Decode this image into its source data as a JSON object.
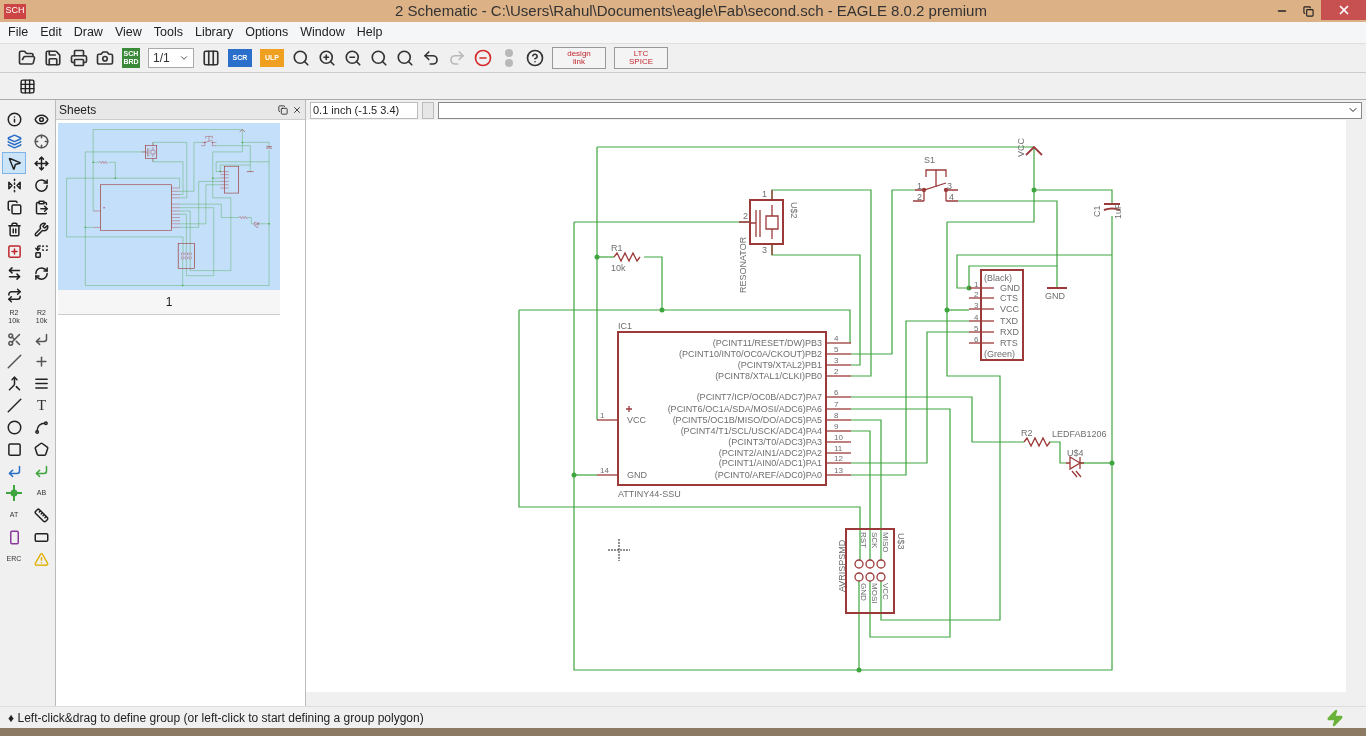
{
  "window": {
    "app_icon_label": "SCH",
    "title": "2 Schematic - C:\\Users\\Rahul\\Documents\\eagle\\Fab\\second.sch - EAGLE 8.0.2 premium"
  },
  "menu": [
    "File",
    "Edit",
    "Draw",
    "View",
    "Tools",
    "Library",
    "Options",
    "Window",
    "Help"
  ],
  "toolbar": [
    {
      "kind": "open",
      "disabled": false
    },
    {
      "kind": "save",
      "disabled": false
    },
    {
      "kind": "print",
      "disabled": false
    },
    {
      "kind": "cam",
      "disabled": false
    },
    {
      "kind": "switch",
      "labels": [
        "SCH",
        "BRD"
      ],
      "disabled": false
    },
    {
      "kind": "sheet",
      "labels": [
        "1/1"
      ],
      "disabled": false
    },
    {
      "kind": "library",
      "disabled": false
    },
    {
      "kind": "script",
      "labels": [
        "SCR"
      ],
      "disabled": false
    },
    {
      "kind": "ulp",
      "labels": [
        "ULP"
      ],
      "disabled": false
    },
    {
      "kind": "zoomfit",
      "disabled": false
    },
    {
      "kind": "zoomin",
      "disabled": false
    },
    {
      "kind": "zoomout",
      "disabled": false
    },
    {
      "kind": "zoomselect",
      "disabled": false
    },
    {
      "kind": "zoomcustom",
      "disabled": false
    },
    {
      "kind": "undo",
      "disabled": false
    },
    {
      "kind": "redo",
      "disabled": true
    },
    {
      "kind": "stop",
      "disabled": false
    },
    {
      "kind": "go",
      "disabled": true
    },
    {
      "kind": "help",
      "disabled": false
    },
    {
      "kind": "designlink",
      "labels": [
        "design",
        "link"
      ],
      "disabled": false
    },
    {
      "kind": "spice",
      "labels": [
        "LTC",
        "SPICE"
      ],
      "disabled": false
    }
  ],
  "tools": [
    {
      "kind": "info",
      "selected": false
    },
    {
      "kind": "show",
      "selected": false
    },
    {
      "kind": "layers",
      "selected": false
    },
    {
      "kind": "mark",
      "selected": false
    },
    {
      "kind": "group",
      "selected": true
    },
    {
      "kind": "move",
      "selected": false
    },
    {
      "kind": "mirror",
      "selected": false
    },
    {
      "kind": "rotate",
      "selected": false
    },
    {
      "kind": "copy",
      "selected": false
    },
    {
      "kind": "paste",
      "selected": false
    },
    {
      "kind": "delete",
      "selected": false
    },
    {
      "kind": "change",
      "selected": false
    },
    {
      "kind": "add",
      "selected": false
    },
    {
      "kind": "replace",
      "selected": false
    },
    {
      "kind": "pinswap",
      "selected": false
    },
    {
      "kind": "gateswap",
      "selected": false
    },
    {
      "kind": "invoke",
      "selected": false
    },
    {
      "kind": "name",
      "labels": [
        "R2",
        "10k"
      ],
      "selected": false
    },
    {
      "kind": "value",
      "labels": [
        "R2",
        "10k"
      ],
      "selected": false
    },
    {
      "kind": "smash",
      "selected": false
    },
    {
      "kind": "miter",
      "selected": false
    },
    {
      "kind": "split",
      "selected": false
    },
    {
      "kind": "optimize",
      "selected": false
    },
    {
      "kind": "connect",
      "selected": false
    },
    {
      "kind": "align",
      "selected": false
    },
    {
      "kind": "line",
      "selected": false
    },
    {
      "kind": "text",
      "labels": [
        "T"
      ],
      "selected": false
    },
    {
      "kind": "circle",
      "selected": false
    },
    {
      "kind": "arc",
      "selected": false
    },
    {
      "kind": "rect",
      "selected": false
    },
    {
      "kind": "polygon",
      "selected": false
    },
    {
      "kind": "bus",
      "selected": false
    },
    {
      "kind": "net",
      "selected": false
    },
    {
      "kind": "junction",
      "selected": false
    },
    {
      "kind": "label",
      "labels": [
        "AB"
      ],
      "selected": false
    },
    {
      "kind": "attribute",
      "labels": [
        "AT"
      ],
      "selected": false
    },
    {
      "kind": "dimension",
      "selected": false
    },
    {
      "kind": "frame",
      "selected": false
    },
    {
      "kind": "module",
      "selected": false
    },
    {
      "kind": "erc",
      "labels": [
        "ERC"
      ],
      "selected": false
    },
    {
      "kind": "errors",
      "selected": false
    }
  ],
  "sheets_panel": {
    "title": "Sheets",
    "sheets": [
      {
        "label": "1",
        "selected": true
      }
    ]
  },
  "coordinate_display": "0.1 inch (-1.5 3.4)",
  "schematic": {
    "parts": [
      {
        "kind": "resistor",
        "name": "R1",
        "value": "10k"
      },
      {
        "kind": "resonator",
        "name": "U$2",
        "value": "RESONATOR",
        "pins": [
          "1",
          "2",
          "3"
        ]
      },
      {
        "kind": "switch",
        "name": "S1",
        "pins": [
          "1",
          "2",
          "3",
          "4"
        ]
      },
      {
        "kind": "supply",
        "name": "VCC"
      },
      {
        "kind": "capacitor",
        "name": "C1",
        "value": "1uF"
      },
      {
        "kind": "ground",
        "name": "GND"
      },
      {
        "kind": "header",
        "name": "(Black)",
        "value": "(Green)",
        "pins": [
          {
            "number": "1",
            "label": "GND"
          },
          {
            "number": "2",
            "label": "CTS"
          },
          {
            "number": "3",
            "label": "VCC"
          },
          {
            "number": "4",
            "label": "TXD"
          },
          {
            "number": "5",
            "label": "RXD"
          },
          {
            "number": "6",
            "label": "RTS"
          }
        ]
      },
      {
        "kind": "mcu",
        "name": "IC1",
        "value": "ATTINY44-SSU",
        "left_pins": [
          {
            "number": "1",
            "label": "VCC"
          },
          {
            "number": "14",
            "label": "GND"
          }
        ],
        "right_pins": [
          {
            "number": "4",
            "label": "(PCINT11/RESET/DW)PB3"
          },
          {
            "number": "5",
            "label": "(PCINT10/INT0/OC0A/CKOUT)PB2"
          },
          {
            "number": "3",
            "label": "(PCINT9/XTAL2)PB1"
          },
          {
            "number": "2",
            "label": "(PCINT8/XTAL1/CLKI)PB0"
          },
          {
            "number": "6",
            "label": "(PCINT7/ICP/OC0B/ADC7)PA7"
          },
          {
            "number": "7",
            "label": "(PCINT6/OC1A/SDA/MOSI/ADC6)PA6"
          },
          {
            "number": "8",
            "label": "(PCINT5/OC1B/MISO/DO/ADC5)PA5"
          },
          {
            "number": "9",
            "label": "(PCINT4/T1/SCL/USCK/ADC4)PA4"
          },
          {
            "number": "10",
            "label": "(PCINT3/T0/ADC3)PA3"
          },
          {
            "number": "11",
            "label": "(PCINT2/AIN1/ADC2)PA2"
          },
          {
            "number": "12",
            "label": "(PCINT1/AIN0/ADC1)PA1"
          },
          {
            "number": "13",
            "label": "(PCINT0/AREF/ADC0)PA0"
          }
        ]
      },
      {
        "kind": "resistor",
        "name": "R2"
      },
      {
        "kind": "led",
        "name": "U$4",
        "value": "LEDFAB1206"
      },
      {
        "kind": "isp",
        "name": "U$3",
        "value": "AVRISPSMD",
        "pins": [
          "RST",
          "SCK",
          "MISO",
          "GND",
          "MOSI",
          "VCC"
        ]
      }
    ]
  },
  "status_bar": {
    "message": "♦ Left-click&drag to define group (or left-click to start defining a group polygon)"
  }
}
